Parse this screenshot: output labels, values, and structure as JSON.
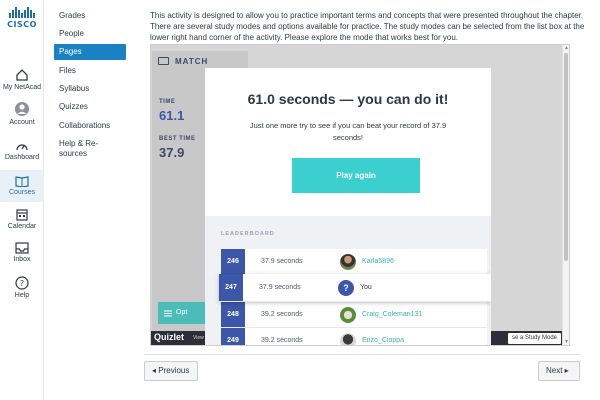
{
  "global_nav": {
    "logo": "CISCO",
    "items": [
      {
        "label": "My NetAcad",
        "icon": "home-icon"
      },
      {
        "label": "Account",
        "icon": "avatar-icon"
      },
      {
        "label": "Dashboard",
        "icon": "dashboard-icon"
      },
      {
        "label": "Courses",
        "icon": "book-icon",
        "active": true
      },
      {
        "label": "Calendar",
        "icon": "calendar-icon"
      },
      {
        "label": "Inbox",
        "icon": "inbox-icon"
      },
      {
        "label": "Help",
        "icon": "help-icon"
      }
    ],
    "accent": "#1e6ea8"
  },
  "course_nav": {
    "items": [
      "Grades",
      "People",
      "Pages",
      "Files",
      "Syllabus",
      "Quizzes",
      "Collaborations",
      "Help & Re-sources"
    ],
    "active_index": 2,
    "active_color": "#1a82c3"
  },
  "intro_text": "This activity is designed to allow you to practice important terms and concepts that were presented throughout the chapter. There are several study modes and options available for practice. The study modes can be selected from the list box at the lower right hand corner of the activity. Please explore the mode that works best for you.",
  "quizlet": {
    "mode_title": "MATCH",
    "time_label": "TIME",
    "time_value": "61.1",
    "best_label": "BEST TIME",
    "best_value": "37.9",
    "options_label": "Opt",
    "brand": "Quizlet",
    "view_link": "View t",
    "study_mode_select": "se a Study Mode",
    "modal": {
      "title": "61.0 seconds — you can do it!",
      "subtitle": "Just one more try to see if you can beat your record of 37.9 seconds!",
      "play_button": "Play again",
      "leaderboard_label": "LEADERBOARD",
      "rows": [
        {
          "rank": "246",
          "time": "37.9 seconds",
          "name": "Karla5896"
        },
        {
          "rank": "247",
          "time": "37.9 seconds",
          "name": "You",
          "is_me": true
        },
        {
          "rank": "248",
          "time": "39.2 seconds",
          "name": "Craig_Coleman131"
        },
        {
          "rank": "249",
          "time": "39.2 seconds",
          "name": "Enzo_Cioppa"
        }
      ],
      "button_color": "#3ccfcf",
      "rank_color": "#3d57a8"
    }
  },
  "pager": {
    "previous": "◂ Previous",
    "next": "Next ▸"
  }
}
